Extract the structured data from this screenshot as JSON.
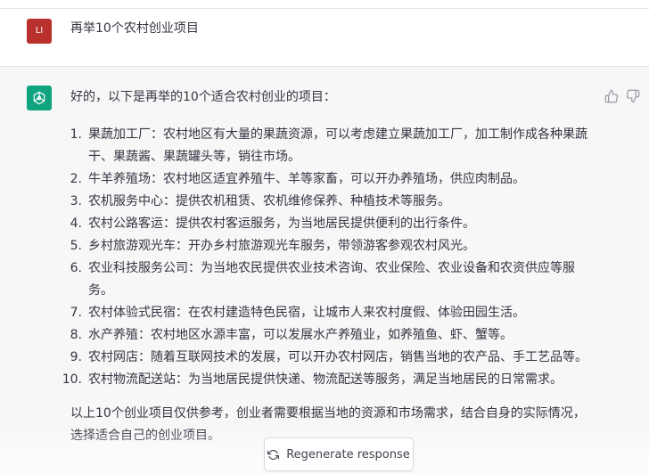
{
  "user_message": {
    "avatar_initials": "LI",
    "text": "再举10个农村创业项目"
  },
  "assistant_message": {
    "intro": "好的，以下是再举的10个适合农村创业的项目：",
    "items": [
      {
        "num": "1.",
        "text": "果蔬加工厂：农村地区有大量的果蔬资源，可以考虑建立果蔬加工厂，加工制作成各种果蔬干、果蔬酱、果蔬罐头等，销往市场。"
      },
      {
        "num": "2.",
        "text": "牛羊养殖场：农村地区适宜养殖牛、羊等家畜，可以开办养殖场，供应肉制品。"
      },
      {
        "num": "3.",
        "text": "农机服务中心：提供农机租赁、农机维修保养、种植技术等服务。"
      },
      {
        "num": "4.",
        "text": "农村公路客运：提供农村客运服务，为当地居民提供便利的出行条件。"
      },
      {
        "num": "5.",
        "text": "乡村旅游观光车：开办乡村旅游观光车服务，带领游客参观农村风光。"
      },
      {
        "num": "6.",
        "text": "农业科技服务公司：为当地农民提供农业技术咨询、农业保险、农业设备和农资供应等服务。"
      },
      {
        "num": "7.",
        "text": "农村体验式民宿：在农村建造特色民宿，让城市人来农村度假、体验田园生活。"
      },
      {
        "num": "8.",
        "text": "水产养殖：农村地区水源丰富，可以发展水产养殖业，如养殖鱼、虾、蟹等。"
      },
      {
        "num": "9.",
        "text": "农村网店：随着互联网技术的发展，可以开办农村网店，销售当地的农产品、手工艺品等。"
      },
      {
        "num": "10.",
        "text": "农村物流配送站：为当地居民提供快递、物流配送等服务，满足当地居民的日常需求。"
      }
    ],
    "outro": "以上10个创业项目仅供参考，创业者需要根据当地的资源和市场需求，结合自身的实际情况，选择适合自己的创业项目。"
  },
  "regenerate_label": "Regenerate response",
  "colors": {
    "user_avatar": "#b9302c",
    "assistant_avatar": "#10a37f",
    "assistant_bg": "#f7f7f8"
  },
  "icons": [
    "openai-logo-icon",
    "thumbs-up-icon",
    "thumbs-down-icon",
    "refresh-icon"
  ]
}
